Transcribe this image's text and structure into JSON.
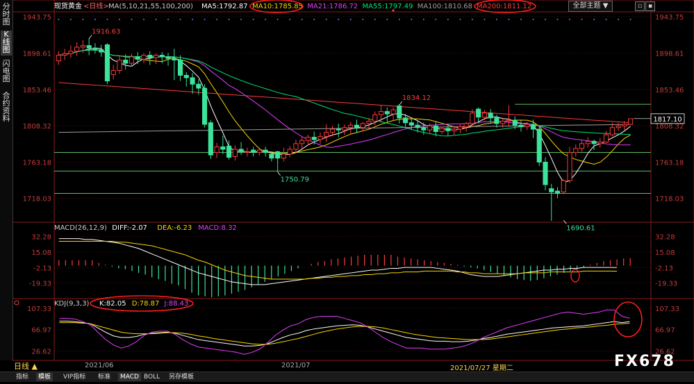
{
  "sidebar": {
    "tabs": [
      {
        "label": "分时图",
        "active": false
      },
      {
        "label": "K线图",
        "active": true
      },
      {
        "label": "闪电图",
        "active": false
      },
      {
        "label": "合约资料",
        "active": false
      }
    ]
  },
  "header": {
    "symbol": "现货黄金",
    "period": "<日线>",
    "ma_params": "MA(5,10,21,55,100,200)",
    "ma": [
      {
        "label": "MA5:1792.87",
        "color": "#ffffff"
      },
      {
        "label": "MA10:1785.85",
        "color": "#ffd700"
      },
      {
        "label": "MA21:1786.72",
        "color": "#e040fb"
      },
      {
        "label": "MA55:1797.49",
        "color": "#00e676"
      },
      {
        "label": "MA100:1810.68",
        "color": "#9e9e9e"
      },
      {
        "label": "MA200:1811.12",
        "color": "#ff3b3b"
      }
    ],
    "theme_dropdown": "全部主题"
  },
  "macd_header": {
    "params": "MACD(26,12,9)",
    "diff": "DIFF:-2.07",
    "dea": "DEA:-6.23",
    "macd": "MACD:8.32"
  },
  "kdj_header": {
    "params": "KDJ(9,3,3)",
    "k": "K:82.05",
    "d": "D:78.87",
    "j": "J:88.43"
  },
  "bottom_tabs": [
    "指标",
    "模板",
    "VIP指标",
    "标准",
    "MACD",
    "BOLL",
    "另存模板"
  ],
  "bottom_active": [
    1,
    4
  ],
  "period_button": "日线 ▲",
  "date_labels": [
    "2021/06",
    "2021/07",
    "2021/07/27 星期二"
  ],
  "watermark": "FX678",
  "colors": {
    "up": "#ff3b3b",
    "down": "#3ce39b",
    "grid": "#8a1a1a",
    "axis_text": "#c43c3c",
    "support": "#7fff7f",
    "price_tag": "#ffffff"
  },
  "chart_data": [
    {
      "type": "candlestick",
      "title": "现货黄金 日线",
      "ylim": [
        1690,
        1950
      ],
      "yticks": [
        1718.03,
        1763.18,
        1808.32,
        1853.46,
        1898.61,
        1943.75
      ],
      "current_price": "1817.10",
      "annotations": [
        {
          "text": "1916.63",
          "index": 5,
          "value": 1916.63
        },
        {
          "text": "1834.12",
          "index": 56,
          "value": 1834.12
        },
        {
          "text": "1750.79",
          "index": 36,
          "value": 1750.79
        },
        {
          "text": "1690.61",
          "index": 83,
          "value": 1690.61
        }
      ],
      "horizontal_lines": [
        1835,
        1775,
        1752,
        1724
      ],
      "candles": [
        [
          1889,
          1901,
          1896,
          1884
        ],
        [
          1896,
          1904,
          1898,
          1890
        ],
        [
          1898,
          1908,
          1901,
          1893
        ],
        [
          1901,
          1912,
          1906,
          1895
        ],
        [
          1906,
          1915,
          1908,
          1899
        ],
        [
          1908,
          1917,
          1905,
          1896
        ],
        [
          1905,
          1911,
          1903,
          1898
        ],
        [
          1903,
          1909,
          1900,
          1894
        ],
        [
          1909,
          1911,
          1864,
          1860
        ],
        [
          1872,
          1884,
          1877,
          1866
        ],
        [
          1877,
          1895,
          1890,
          1873
        ],
        [
          1890,
          1897,
          1886,
          1878
        ],
        [
          1886,
          1898,
          1894,
          1882
        ],
        [
          1894,
          1900,
          1891,
          1885
        ],
        [
          1891,
          1898,
          1896,
          1886
        ],
        [
          1896,
          1901,
          1893,
          1884
        ],
        [
          1893,
          1898,
          1896,
          1885
        ],
        [
          1896,
          1900,
          1894,
          1886
        ],
        [
          1894,
          1899,
          1892,
          1883
        ],
        [
          1892,
          1904,
          1890,
          1865
        ],
        [
          1890,
          1896,
          1871,
          1864
        ],
        [
          1871,
          1875,
          1868,
          1857
        ],
        [
          1868,
          1874,
          1860,
          1848
        ],
        [
          1860,
          1866,
          1855,
          1847
        ],
        [
          1855,
          1860,
          1810,
          1806
        ],
        [
          1812,
          1815,
          1772,
          1767
        ],
        [
          1775,
          1787,
          1782,
          1768
        ],
        [
          1782,
          1796,
          1779,
          1773
        ],
        [
          1783,
          1790,
          1769,
          1766
        ],
        [
          1770,
          1784,
          1779,
          1765
        ],
        [
          1779,
          1788,
          1776,
          1772
        ],
        [
          1776,
          1781,
          1776,
          1770
        ],
        [
          1778,
          1782,
          1775,
          1770
        ],
        [
          1775,
          1781,
          1778,
          1771
        ],
        [
          1778,
          1782,
          1775,
          1770
        ],
        [
          1773,
          1776,
          1768,
          1764
        ],
        [
          1776,
          1777,
          1768,
          1751
        ],
        [
          1768,
          1781,
          1773,
          1764
        ],
        [
          1773,
          1783,
          1779,
          1769
        ],
        [
          1779,
          1791,
          1786,
          1774
        ],
        [
          1786,
          1794,
          1790,
          1780
        ],
        [
          1790,
          1797,
          1794,
          1784
        ],
        [
          1794,
          1801,
          1791,
          1785
        ],
        [
          1791,
          1800,
          1795,
          1786
        ],
        [
          1795,
          1810,
          1800,
          1788
        ],
        [
          1800,
          1808,
          1804,
          1795
        ],
        [
          1804,
          1811,
          1803,
          1794
        ],
        [
          1803,
          1810,
          1806,
          1797
        ],
        [
          1806,
          1813,
          1809,
          1798
        ],
        [
          1809,
          1816,
          1806,
          1799
        ],
        [
          1806,
          1813,
          1811,
          1801
        ],
        [
          1811,
          1818,
          1814,
          1804
        ],
        [
          1814,
          1826,
          1822,
          1809
        ],
        [
          1822,
          1834,
          1826,
          1813
        ],
        [
          1826,
          1831,
          1823,
          1813
        ],
        [
          1823,
          1831,
          1828,
          1815
        ],
        [
          1833,
          1835,
          1818,
          1811
        ],
        [
          1818,
          1823,
          1812,
          1806
        ],
        [
          1812,
          1818,
          1809,
          1803
        ],
        [
          1809,
          1815,
          1806,
          1800
        ],
        [
          1806,
          1812,
          1803,
          1797
        ],
        [
          1803,
          1811,
          1808,
          1798
        ],
        [
          1808,
          1814,
          1801,
          1795
        ],
        [
          1801,
          1807,
          1805,
          1798
        ],
        [
          1805,
          1811,
          1802,
          1796
        ],
        [
          1802,
          1808,
          1804,
          1797
        ],
        [
          1804,
          1810,
          1807,
          1799
        ],
        [
          1807,
          1813,
          1811,
          1801
        ],
        [
          1811,
          1829,
          1824,
          1808
        ],
        [
          1829,
          1831,
          1819,
          1811
        ],
        [
          1819,
          1828,
          1824,
          1815
        ],
        [
          1824,
          1829,
          1818,
          1812
        ],
        [
          1818,
          1822,
          1811,
          1806
        ],
        [
          1811,
          1817,
          1814,
          1806
        ],
        [
          1814,
          1834,
          1815,
          1807
        ],
        [
          1815,
          1820,
          1809,
          1804
        ],
        [
          1809,
          1815,
          1807,
          1801
        ],
        [
          1807,
          1813,
          1810,
          1803
        ],
        [
          1810,
          1816,
          1804,
          1793
        ],
        [
          1804,
          1808,
          1763,
          1758
        ],
        [
          1763,
          1769,
          1735,
          1728
        ],
        [
          1730,
          1736,
          1726,
          1690
        ],
        [
          1727,
          1732,
          1724,
          1718
        ],
        [
          1726,
          1742,
          1740,
          1723
        ],
        [
          1740,
          1782,
          1775,
          1737
        ],
        [
          1775,
          1785,
          1780,
          1770
        ],
        [
          1780,
          1790,
          1786,
          1776
        ],
        [
          1786,
          1794,
          1789,
          1781
        ],
        [
          1789,
          1791,
          1786,
          1778
        ],
        [
          1786,
          1793,
          1788,
          1781
        ],
        [
          1788,
          1802,
          1797,
          1787
        ],
        [
          1797,
          1812,
          1806,
          1795
        ],
        [
          1806,
          1812,
          1808,
          1802
        ],
        [
          1808,
          1814,
          1810,
          1803
        ],
        [
          1810,
          1813,
          1817,
          1809
        ]
      ]
    },
    {
      "type": "bar",
      "title": "MACD(26,12,9)",
      "ylim": [
        -35,
        42
      ],
      "yticks": [
        -19.33,
        -2.13,
        15.08,
        32.28
      ],
      "series": [
        {
          "name": "MACD",
          "values": [
            6,
            6,
            6,
            6,
            6,
            6,
            3,
            1,
            -1,
            -3,
            -4,
            -6,
            -8,
            -10,
            -13,
            -15,
            -17,
            -20,
            -22,
            -26,
            -30,
            -33,
            -34,
            -35,
            -34,
            -33,
            -31,
            -29,
            -27,
            -24,
            -21,
            -18,
            -15,
            -12,
            -9,
            -6,
            -3,
            0,
            2,
            4,
            5,
            7,
            8,
            9,
            10,
            11,
            12,
            12,
            12,
            12,
            12,
            10,
            9,
            8,
            7,
            6,
            5,
            4,
            3,
            2,
            1,
            -1,
            -2,
            -3,
            -5,
            -7,
            -9,
            -11,
            -13,
            -15,
            -16,
            -17,
            -16,
            -14,
            -12,
            -10,
            -8,
            -6,
            -4,
            -2,
            1,
            3,
            5,
            6,
            7,
            8,
            8.32
          ]
        },
        {
          "name": "DIFF",
          "values": [
            30,
            30,
            30,
            30,
            29,
            29,
            28,
            27,
            26,
            25,
            23,
            21,
            19,
            16,
            13,
            10,
            7,
            4,
            1,
            -2,
            -5,
            -8,
            -10,
            -12,
            -14,
            -16,
            -18,
            -19,
            -20,
            -21,
            -21,
            -21,
            -20,
            -19,
            -18,
            -17,
            -16,
            -15,
            -14,
            -13,
            -12,
            -11,
            -10,
            -9,
            -8,
            -7,
            -6,
            -5,
            -5,
            -4,
            -3,
            -3,
            -2,
            -2,
            -2,
            -2,
            -2,
            -3,
            -4,
            -5,
            -6,
            -8,
            -10,
            -11,
            -12,
            -12,
            -12,
            -11,
            -10,
            -9,
            -8,
            -7,
            -6,
            -5,
            -5,
            -4,
            -4,
            -3,
            -3,
            -2,
            -2,
            -2,
            -2,
            -2,
            -2.07
          ]
        },
        {
          "name": "DEA",
          "values": [
            27,
            27,
            27,
            27,
            27,
            27,
            27,
            27,
            27,
            26,
            26,
            25,
            24,
            23,
            22,
            20,
            18,
            16,
            14,
            12,
            9,
            6,
            4,
            1,
            -2,
            -5,
            -7,
            -9,
            -11,
            -12,
            -13,
            -14,
            -15,
            -15,
            -15,
            -15,
            -15,
            -15,
            -14,
            -14,
            -13,
            -13,
            -12,
            -12,
            -11,
            -11,
            -10,
            -10,
            -9,
            -9,
            -8,
            -8,
            -7,
            -7,
            -7,
            -6,
            -6,
            -6,
            -6,
            -6,
            -7,
            -7,
            -8,
            -8,
            -9,
            -9,
            -9,
            -9,
            -9,
            -9,
            -8,
            -8,
            -8,
            -8,
            -7,
            -7,
            -7,
            -7,
            -7,
            -6,
            -6,
            -6,
            -6,
            -6,
            -6.23
          ]
        }
      ]
    },
    {
      "type": "line",
      "title": "KDJ(9,3,3)",
      "ylim": [
        10,
        115
      ],
      "yticks": [
        26.62,
        66.97,
        107.33
      ],
      "series": [
        {
          "name": "K",
          "values": [
            83,
            83,
            82,
            80,
            78,
            70,
            62,
            55,
            52,
            52,
            54,
            58,
            60,
            61,
            62,
            60,
            56,
            52,
            48,
            46,
            44,
            42,
            40,
            38,
            36,
            36,
            37,
            40,
            46,
            52,
            57,
            60,
            65,
            68,
            70,
            72,
            74,
            75,
            76,
            75,
            72,
            68,
            64,
            60,
            56,
            52,
            50,
            48,
            46,
            45,
            45,
            44,
            44,
            45,
            47,
            50,
            52,
            55,
            58,
            60,
            62,
            64,
            66,
            68,
            70,
            71,
            72,
            73,
            74,
            76,
            78,
            80,
            82,
            80,
            82.05
          ]
        },
        {
          "name": "D",
          "values": [
            80,
            80,
            80,
            79,
            78,
            74,
            70,
            66,
            62,
            60,
            59,
            59,
            59,
            60,
            61,
            61,
            60,
            58,
            55,
            53,
            50,
            48,
            46,
            44,
            42,
            40,
            39,
            39,
            41,
            44,
            47,
            50,
            54,
            58,
            62,
            65,
            68,
            70,
            72,
            73,
            73,
            72,
            70,
            67,
            64,
            61,
            58,
            56,
            54,
            52,
            51,
            50,
            49,
            48,
            48,
            48,
            49,
            51,
            53,
            55,
            57,
            59,
            61,
            63,
            65,
            67,
            68,
            70,
            71,
            72,
            74,
            75,
            77,
            78,
            78.87
          ]
        },
        {
          "name": "J",
          "values": [
            88,
            88,
            87,
            82,
            76,
            62,
            48,
            38,
            32,
            36,
            44,
            56,
            62,
            64,
            64,
            58,
            48,
            40,
            34,
            32,
            30,
            28,
            26,
            24,
            20,
            24,
            30,
            42,
            56,
            66,
            74,
            78,
            86,
            90,
            92,
            92,
            92,
            88,
            84,
            80,
            72,
            62,
            52,
            44,
            38,
            32,
            32,
            32,
            30,
            30,
            30,
            32,
            34,
            38,
            44,
            52,
            58,
            64,
            70,
            74,
            78,
            82,
            86,
            90,
            94,
            98,
            100,
            98,
            96,
            98,
            100,
            104,
            104,
            92,
            88.43
          ]
        }
      ]
    }
  ]
}
